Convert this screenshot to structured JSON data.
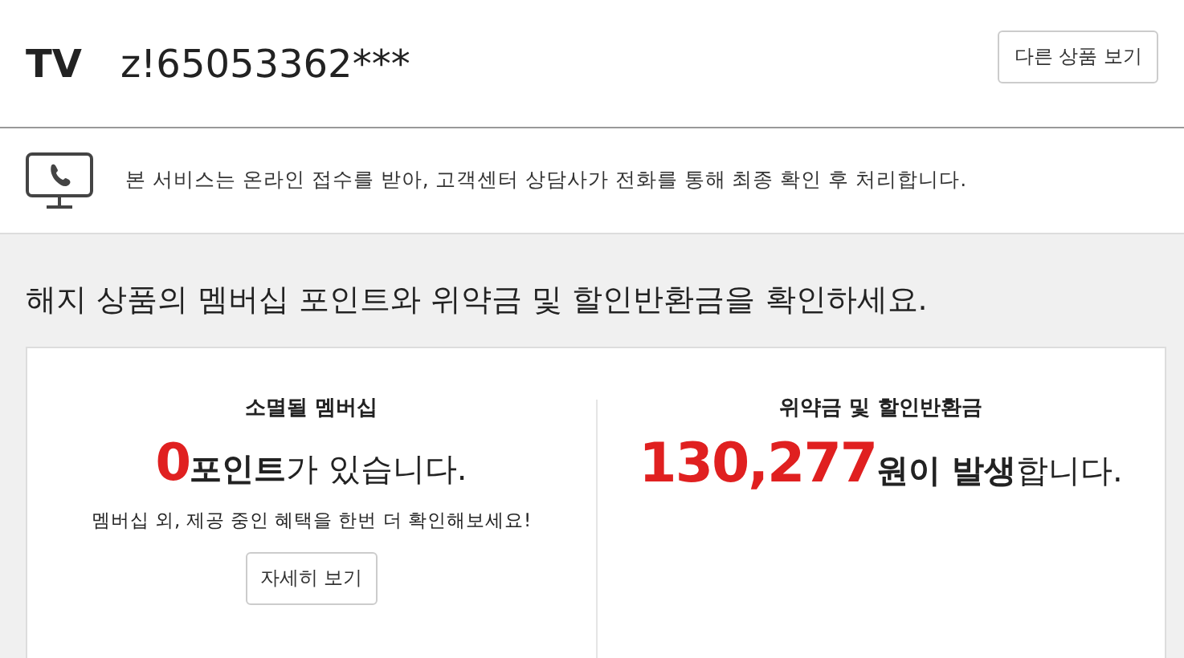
{
  "header": {
    "product": "TV",
    "account": "z!65053362***",
    "other_button": "다른 상품 보기"
  },
  "notice": {
    "text": "본 서비스는 온라인 접수를 받아, 고객센터 상담사가 전화를 통해 최종 확인 후 처리합니다."
  },
  "heading": "해지 상품의 멤버십 포인트와 위약금 및 할인반환금을 확인하세요.",
  "panels": [
    {
      "kind": "membership",
      "title": "소멸될 멤버십",
      "amount": "0",
      "message": "**포인트**가 있습니다.",
      "note": "멤버십 외, 제공 중인 혜택을 한번 더 확인해보세요!",
      "button": "자세히 보기"
    },
    {
      "kind": "penalty",
      "title": "위약금 및 할인반환금",
      "amount": "130,277",
      "message": "**원이 발생**합니다."
    }
  ]
}
